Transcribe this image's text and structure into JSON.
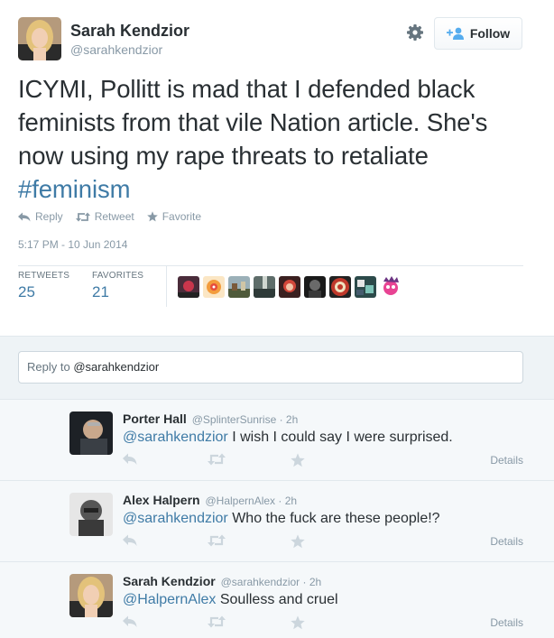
{
  "tweet": {
    "name": "Sarah Kendzior",
    "handle": "@sarahkendzior",
    "follow_label": "Follow",
    "text_main": "ICYMI, Pollitt is mad that I defended black feminists from that vile Nation article. She's now using my rape threats to retaliate ",
    "hashtag": "#feminism",
    "actions": {
      "reply": "Reply",
      "retweet": "Retweet",
      "favorite": "Favorite"
    },
    "timestamp": "5:17 PM - 10 Jun 2014",
    "stats": {
      "retweets_label": "RETWEETS",
      "retweets_value": "25",
      "favorites_label": "FAVORITES",
      "favorites_value": "21"
    }
  },
  "reply_box": {
    "prefix": "Reply to ",
    "mention": "@sarahkendzior"
  },
  "replies": [
    {
      "name": "Porter Hall",
      "meta": "@SplinterSunrise · 2h",
      "mention": "@sarahkendzior",
      "text": " I wish I could say I were surprised.",
      "details": "Details"
    },
    {
      "name": "Alex Halpern",
      "meta": "@HalpernAlex · 2h",
      "mention": "@sarahkendzior",
      "text": " Who the fuck are these people!?",
      "details": "Details"
    },
    {
      "name": "Sarah Kendzior",
      "meta": "@sarahkendzior · 2h",
      "mention": "@HalpernAlex",
      "text": " Soulless and cruel",
      "details": "Details"
    }
  ],
  "colors": {
    "link": "#3f7ba6",
    "muted": "#8899a6",
    "text": "#292f33",
    "reply_bg": "#f5f8fa"
  }
}
